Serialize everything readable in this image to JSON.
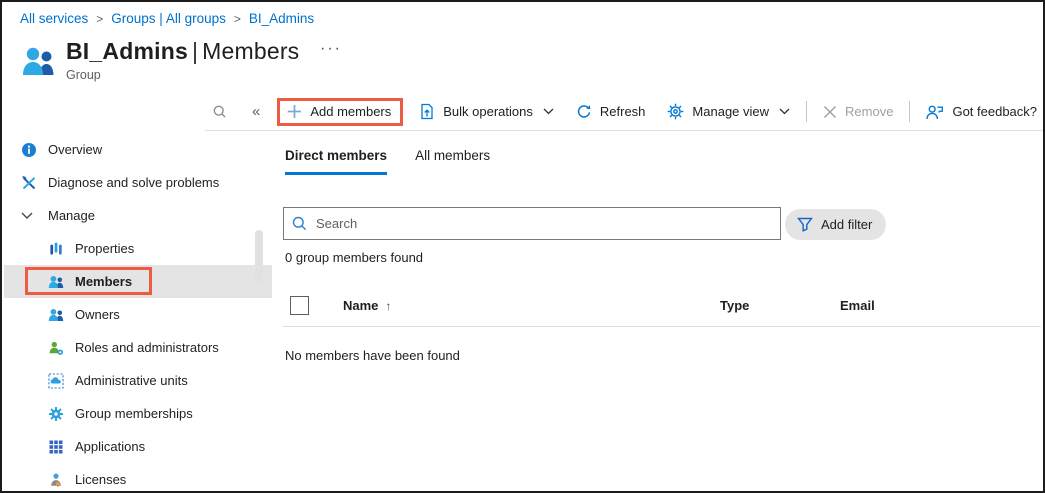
{
  "breadcrumb": {
    "separator": ">",
    "items": [
      "All services",
      "Groups | All groups",
      "BI_Admins"
    ]
  },
  "header": {
    "title": "BI_Admins",
    "divider": "|",
    "section": "Members",
    "subtitle": "Group",
    "more": "···"
  },
  "menu_controls": {
    "collapse": "«"
  },
  "toolbar": {
    "add_members": "Add members",
    "bulk_operations": "Bulk operations",
    "refresh": "Refresh",
    "manage_view": "Manage view",
    "remove": "Remove",
    "feedback": "Got feedback?"
  },
  "sidebar": {
    "items": [
      {
        "label": "Overview"
      },
      {
        "label": "Diagnose and solve problems"
      },
      {
        "label": "Manage"
      },
      {
        "label": "Properties"
      },
      {
        "label": "Members"
      },
      {
        "label": "Owners"
      },
      {
        "label": "Roles and administrators"
      },
      {
        "label": "Administrative units"
      },
      {
        "label": "Group memberships"
      },
      {
        "label": "Applications"
      },
      {
        "label": "Licenses"
      }
    ]
  },
  "tabs": [
    {
      "label": "Direct members"
    },
    {
      "label": "All members"
    }
  ],
  "filters": {
    "search_placeholder": "Search",
    "add_filter": "Add filter"
  },
  "results": {
    "count": "0 group members found",
    "empty": "No members have been found",
    "sort_arrow": "↑"
  },
  "table": {
    "columns": [
      "Name",
      "Type",
      "Email"
    ]
  },
  "colors": {
    "accent": "#0078d4",
    "link": "#0072c9",
    "annotation_red": "#ee5b43",
    "selected_row_bg": "#e4e4e4",
    "disabled_text": "#a19f9d"
  }
}
